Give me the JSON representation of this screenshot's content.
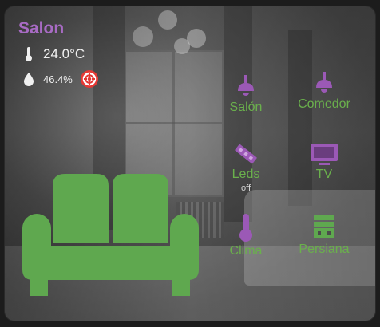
{
  "card": {
    "title": "Salon",
    "temperature": "24.0°C",
    "humidity": "46.4%",
    "title_color": "#a86bc4",
    "icon_color": "#9b59b6",
    "label_color": "#6ab04c",
    "sofa_color": "#5fa84f",
    "alert_color": "#e53935"
  },
  "buttons": [
    {
      "label": "Salón",
      "icon": "ceiling-lamp-icon"
    },
    {
      "label": "Comedor",
      "icon": "ceiling-lamp-icon"
    },
    {
      "label": "Leds",
      "state": "off",
      "icon": "led-strip-icon"
    },
    {
      "label": "TV",
      "icon": "television-icon"
    },
    {
      "label": "Clima",
      "icon": "thermometer-icon"
    },
    {
      "label": "Persiana",
      "icon": "window-shutter-icon"
    }
  ]
}
